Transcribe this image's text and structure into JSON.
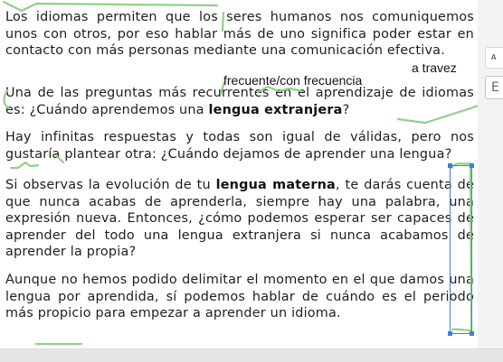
{
  "document": {
    "paragraphs": {
      "p1": "Los idiomas permiten que los seres humanos nos comuniquemos unos con otros, por eso hablar más de uno significa poder estar en contacto con más personas mediante una comunicación efectiva.",
      "p2_a": "Una de las preguntas más recurrentes en el aprendizaje de idiomas es: ¿Cuándo aprendemos una ",
      "p2_bold": "lengua extranjera",
      "p2_b": "?",
      "p3": "Hay infinitas respuestas y todas son igual de válidas, pero nos gustaría plantear otra: ¿Cuándo dejamos de aprender una lengua?",
      "p4_a": "Si observas la evolución de tu ",
      "p4_bold": "lengua materna",
      "p4_b": ", te darás cuenta de que nunca acabas de aprenderla, siempre hay una palabra, una expresión nueva. Entonces, ¿cómo podemos esperar ser capaces de aprender del todo una lengua extranjera si nunca acabamos de aprender la propia?",
      "p5": "Aunque no hemos podido delimitar el momento en el que damos una lengua por aprendida, sí podemos hablar de cuándo es el periodo más propicio para empezar a aprender un idioma."
    },
    "handwritten": {
      "frecuente": "frecuente/con frecuencia",
      "a_travez": "a travez"
    }
  },
  "side_panel": {
    "button_1": "A",
    "button_2": "E"
  },
  "colors": {
    "annotation_green": "#8fd18a",
    "selection_blue": "#3f7fd9"
  }
}
